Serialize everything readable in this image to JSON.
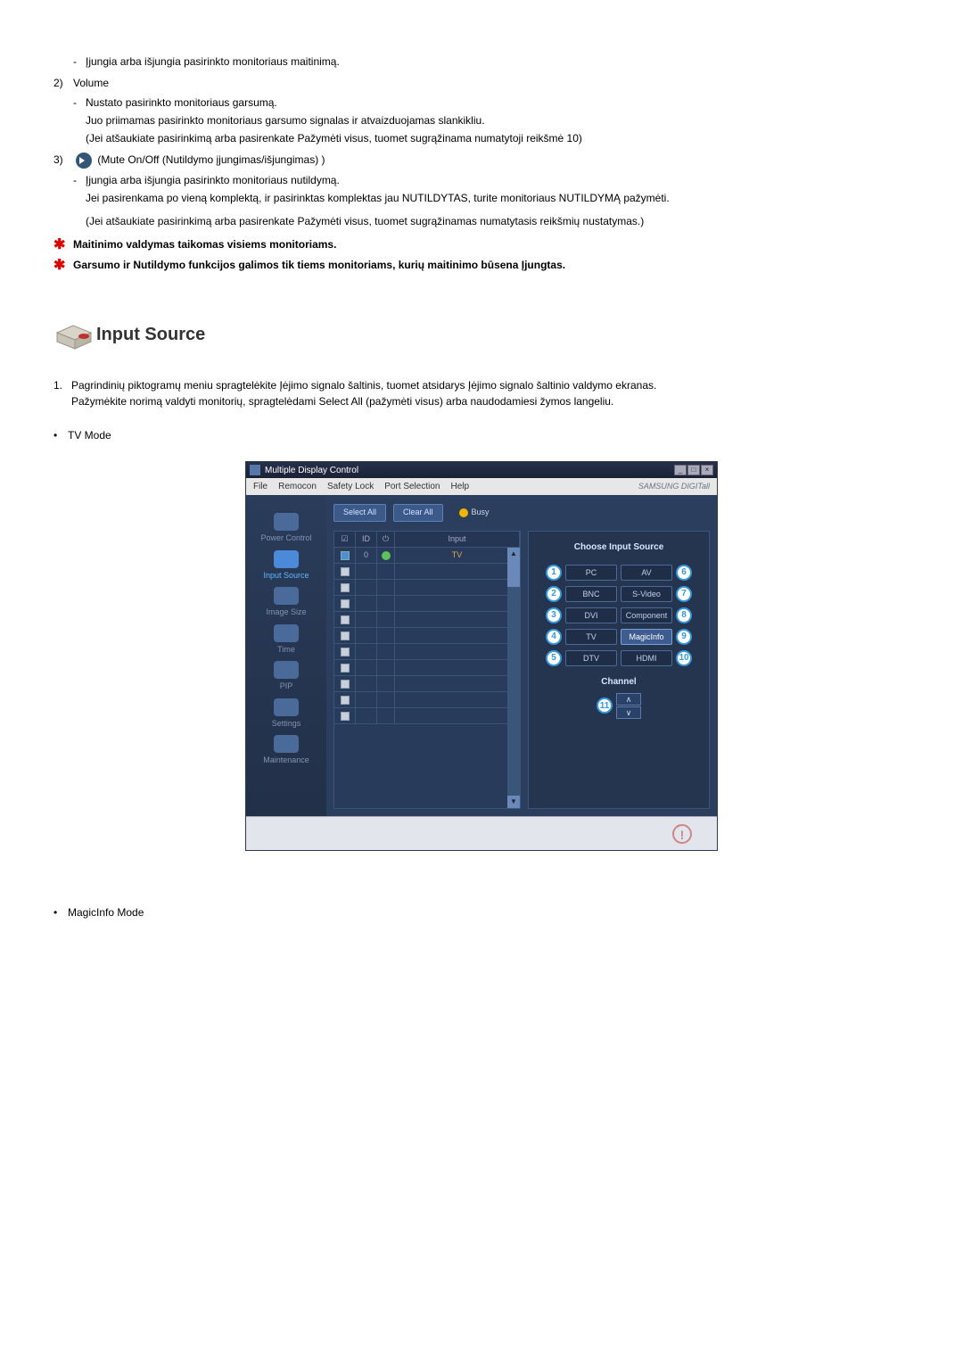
{
  "top": {
    "item1_dash1": "Įjungia arba išjungia pasirinkto monitoriaus maitinimą.",
    "item2_num": "2)",
    "item2_label": "Volume",
    "item2_dash1": "Nustato pasirinkto monitoriaus garsumą.",
    "item2_line2": "Juo priimamas pasirinkto monitoriaus garsumo signalas ir atvaizduojamas slankikliu.",
    "item2_line3": "(Jei atšaukiate pasirinkimą arba pasirenkate Pažymėti visus, tuomet sugrąžinama numatytoji reikšmė 10)",
    "item3_num": "3)",
    "item3_label": "(Mute On/Off (Nutildymo įjungimas/išjungimas) )",
    "item3_dash1": "Įjungia arba išjungia pasirinkto monitoriaus nutildymą.",
    "item3_line2": "Jei pasirenkama po vieną komplektą, ir pasirinktas komplektas jau NUTILDYTAS, turite monitoriaus NUTILDYMĄ pažymėti.",
    "item3_line3": "(Jei atšaukiate pasirinkimą arba pasirenkate Pažymėti visus, tuomet sugrąžinamas numatytasis reikšmių nustatymas.)",
    "star1": "Maitinimo valdymas taikomas visiems monitoriams.",
    "star2": "Garsumo ir Nutildymo funkcijos galimos tik tiems monitoriams, kurių maitinimo būsena Įjungtas."
  },
  "section": {
    "title": "Input Source",
    "step1_num": "1.",
    "step1_text": "Pagrindinių piktogramų meniu spragtelėkite Įėjimo signalo šaltinis, tuomet atsidarys Įėjimo signalo šaltinio valdymo ekranas.",
    "step1_text2": "Pažymėkite norimą valdyti monitorių, spragtelėdami Select All (pažymėti visus) arba naudodamiesi žymos langeliu.",
    "bullet1": "TV Mode",
    "bullet2": "MagicInfo Mode"
  },
  "app": {
    "title": "Multiple Display Control",
    "menu": {
      "file": "File",
      "remocon": "Remocon",
      "safety": "Safety Lock",
      "port": "Port Selection",
      "help": "Help"
    },
    "brand": "SAMSUNG DIGITall",
    "sidebar": {
      "power": "Power Control",
      "input": "Input Source",
      "image": "Image Size",
      "time": "Time",
      "pip": "PIP",
      "settings": "Settings",
      "maint": "Maintenance"
    },
    "toolbar": {
      "select_all": "Select All",
      "clear_all": "Clear All",
      "busy": "Busy"
    },
    "table": {
      "h_chk": "☑",
      "h_id": "ID",
      "h_pwr": "⏻",
      "h_inp": "Input",
      "row0_id": "0",
      "row0_inp": "TV"
    },
    "panel": {
      "title": "Choose Input Source",
      "b1": "1",
      "s1": "PC",
      "b2": "2",
      "s2": "BNC",
      "b3": "3",
      "s3": "DVI",
      "b4": "4",
      "s4": "TV",
      "b5": "5",
      "s5": "DTV",
      "b6": "6",
      "s6": "AV",
      "b7": "7",
      "s7": "S-Video",
      "b8": "8",
      "s8": "Component",
      "b9": "9",
      "s9": "MagicInfo",
      "b10": "10",
      "s10": "HDMI",
      "b11": "11",
      "channel": "Channel"
    }
  }
}
